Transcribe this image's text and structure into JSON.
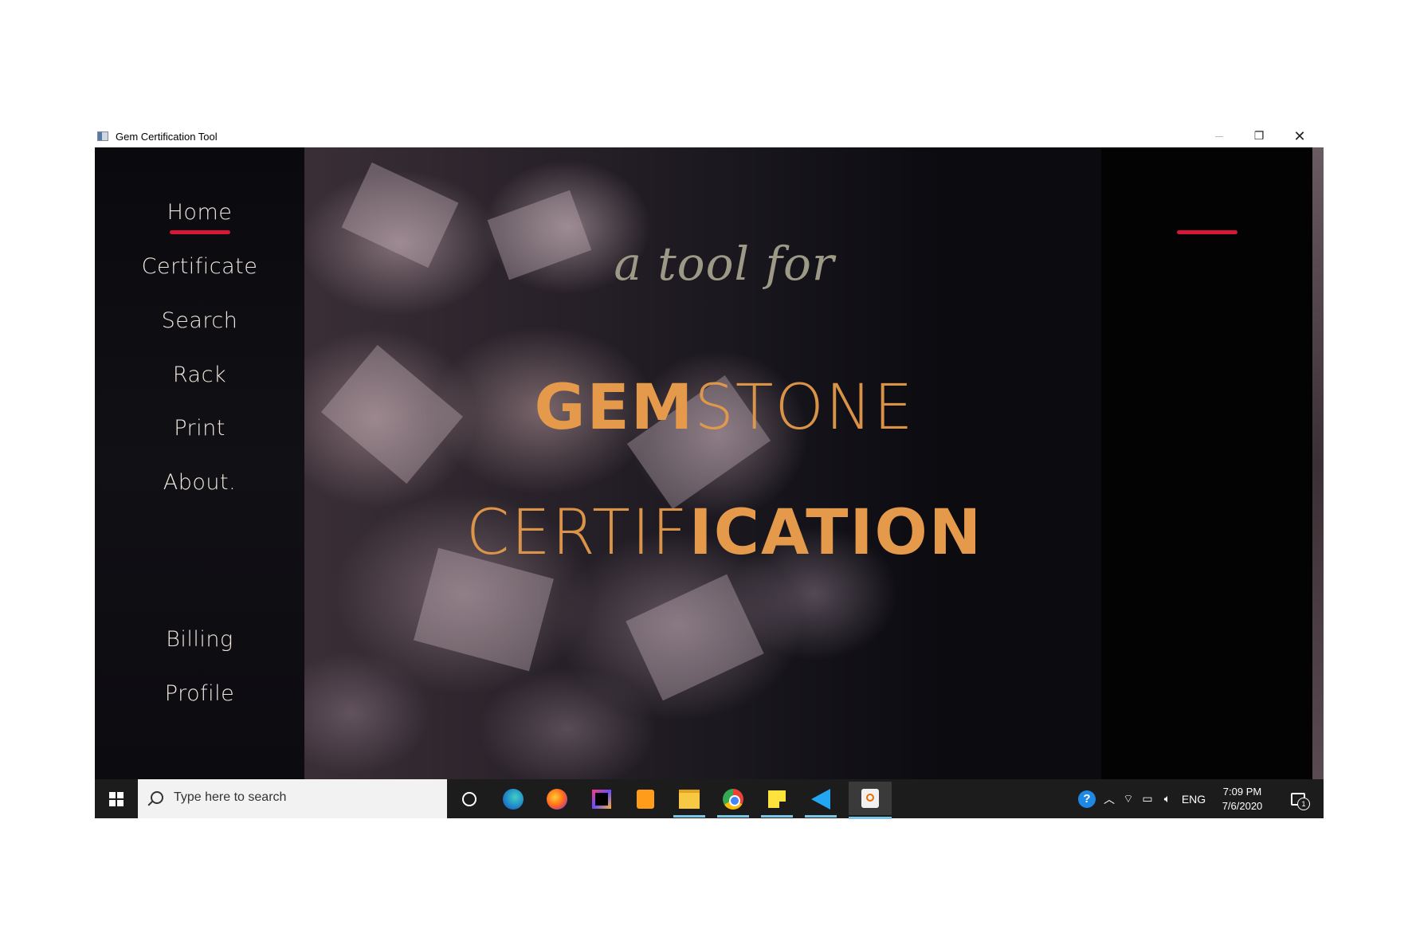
{
  "window": {
    "title": "Gem Certification Tool"
  },
  "sidebar": {
    "items": [
      {
        "label": "Home",
        "active": true
      },
      {
        "label": "Certificate"
      },
      {
        "label": "Search"
      },
      {
        "label": "Rack"
      },
      {
        "label": "Print"
      },
      {
        "label": "About."
      },
      {
        "label": "Billing"
      },
      {
        "label": "Profile"
      }
    ]
  },
  "hero": {
    "tagline": "a tool for",
    "line1_bold": "GEM",
    "line1_light": "STONE",
    "line2_light": "CERTIF",
    "line2_bold": "ICATION"
  },
  "colors": {
    "accent": "#d7163a",
    "headline": "#e49a4a",
    "nav_text": "#efe7dc",
    "tagline": "#9c9a86"
  },
  "taskbar": {
    "search_placeholder": "Type here to search",
    "icons": [
      "cortana-icon",
      "edge-icon",
      "firefox-icon",
      "intellij-icon",
      "sublime-text-icon",
      "file-explorer-icon",
      "chrome-icon",
      "sticky-notes-icon",
      "vscode-icon",
      "java-app-icon"
    ],
    "tray": {
      "language": "ENG",
      "time": "7:09 PM",
      "date": "7/6/2020",
      "notification_count": "1"
    }
  }
}
